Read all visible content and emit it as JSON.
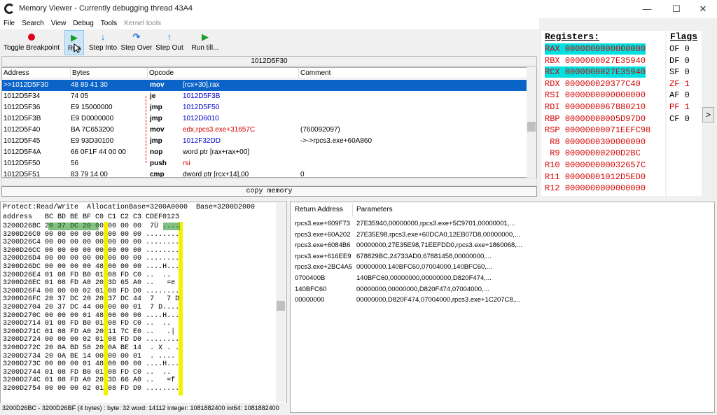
{
  "window": {
    "title": "Memory Viewer - Currently debugging thread 43A4",
    "minimize": "—",
    "maximize": "☐",
    "close": "✕"
  },
  "menu": [
    "File",
    "Search",
    "View",
    "Debug",
    "Tools",
    "Kernel tools"
  ],
  "toolbar": {
    "toggle_breakpoint": "Toggle Breakpoint",
    "run": "Run",
    "step_into": "Step Into",
    "step_over": "Step Over",
    "step_out": "Step Out",
    "run_till": "Run till..."
  },
  "disasm": {
    "address_header": "1012D5F30",
    "columns": [
      "Address",
      "Bytes",
      "Opcode",
      "Comment"
    ],
    "rows": [
      {
        "addr": ">>1012D5F30",
        "bytes": "48 89 41 30",
        "op": "mov",
        "args": "[rcx+30],rax",
        "comment": "",
        "selected": true
      },
      {
        "addr": "1012D5F34",
        "bytes": "74 05",
        "op": "je",
        "args": "1012D5F3B",
        "comment": ""
      },
      {
        "addr": "1012D5F36",
        "bytes": "E9 15000000",
        "op": "jmp",
        "args": "1012D5F50",
        "comment": ""
      },
      {
        "addr": "1012D5F3B",
        "bytes": "E9 D0000000",
        "op": "jmp",
        "args": "1012D6010",
        "comment": ""
      },
      {
        "addr": "1012D5F40",
        "bytes": "BA 7C653200",
        "op": "mov",
        "args": "edx,rpcs3.exe+31657C",
        "comment": "(760092097)"
      },
      {
        "addr": "1012D5F45",
        "bytes": "E9 93D30100",
        "op": "jmp",
        "args": "1012F32DD",
        "comment": "->->rpcs3.exe+60A860"
      },
      {
        "addr": "1012D5F4A",
        "bytes": "66 0F1F 44 00 00",
        "op": "nop",
        "args": "word ptr [rax+rax+00]",
        "comment": ""
      },
      {
        "addr": "1012D5F50",
        "bytes": "56",
        "op": "push",
        "args": "rsi",
        "comment": ""
      },
      {
        "addr": "1012D5F51",
        "bytes": "83 79 14 00",
        "op": "cmp",
        "args": "dword ptr [rcx+14],00",
        "comment": "0"
      }
    ]
  },
  "copy_memory": "copy memory",
  "registers": {
    "header": "Registers:",
    "list": [
      {
        "name": "RAX",
        "value": "0000000000000000",
        "hl": true
      },
      {
        "name": "RBX",
        "value": "0000000027E35940"
      },
      {
        "name": "RCX",
        "value": "0000000027E35940",
        "hl": true
      },
      {
        "name": "RDX",
        "value": "000000020377C40"
      },
      {
        "name": "RSI",
        "value": "0000000000000000"
      },
      {
        "name": "RDI",
        "value": "0000000067880210"
      },
      {
        "name": "RBP",
        "value": "00000000005D97D0"
      },
      {
        "name": "RSP",
        "value": "00000000071EEFC98"
      },
      {
        "name": " R8",
        "value": "0000000300000000"
      },
      {
        "name": " R9",
        "value": "00000000200D2BC"
      },
      {
        "name": "R10",
        "value": "000000000032657C"
      },
      {
        "name": "R11",
        "value": "00000001012D5ED0"
      },
      {
        "name": "R12",
        "value": "0000000000000000"
      }
    ]
  },
  "flags": {
    "header": "Flags",
    "list": [
      {
        "name": "OF",
        "value": "0",
        "red": false
      },
      {
        "name": "DF",
        "value": "0",
        "red": false
      },
      {
        "name": "SF",
        "value": "0",
        "red": false
      },
      {
        "name": "ZF",
        "value": "1",
        "red": true
      },
      {
        "name": "AF",
        "value": "0",
        "red": false
      },
      {
        "name": "PF",
        "value": "1",
        "red": true
      },
      {
        "name": "CF",
        "value": "0",
        "red": false
      }
    ]
  },
  "expand": ">",
  "hex": {
    "info": "Protect:Read/Write  AllocationBase=3200A0000  Base=3200D2000",
    "header": "address   BC BD BE BF C0 C1 C2 C3 CDEF0123",
    "rows": [
      {
        "addr": "3200D26BC",
        "bytes": "20 37 DC 20 00 00 00 00",
        "ascii": " 7Ü ...."
      },
      {
        "addr": "3200D26C0",
        "bytes": "00 00 00 00 00 00 00 00",
        "ascii": "........"
      },
      {
        "addr": "3200D26C4",
        "bytes": "00 00 00 00 00 00 00 00",
        "ascii": "........"
      },
      {
        "addr": "3200D26CC",
        "bytes": "00 00 00 00 00 00 00 00",
        "ascii": "........"
      },
      {
        "addr": "3200D26D4",
        "bytes": "00 00 00 00 00 00 00 00",
        "ascii": "........"
      },
      {
        "addr": "3200D26DC",
        "bytes": "00 00 00 00 48 00 00 00",
        "ascii": "....H..."
      },
      {
        "addr": "3200D26E4",
        "bytes": "01 08 FD B0 01 08 FD C0",
        "ascii": "..  ..  "
      },
      {
        "addr": "3200D26EC",
        "bytes": "01 08 FD A0 20 3D 65 A0",
        "ascii": "..   =e "
      },
      {
        "addr": "3200D26F4",
        "bytes": "00 00 00 02 01 08 FD D0",
        "ascii": "........"
      },
      {
        "addr": "3200D26FC",
        "bytes": "20 37 DC 20 20 37 DC 44",
        "ascii": " 7   7 D"
      },
      {
        "addr": "3200D2704",
        "bytes": "20 37 DC 44 00 00 00 01",
        "ascii": " 7 D...."
      },
      {
        "addr": "3200D270C",
        "bytes": "00 00 00 01 48 00 00 00",
        "ascii": "....H..."
      },
      {
        "addr": "3200D2714",
        "bytes": "01 08 FD B0 01 08 FD C0",
        "ascii": "..  ..  "
      },
      {
        "addr": "3200D271C",
        "bytes": "01 08 FD A0 20 11 7C E0",
        "ascii": "..   .| "
      },
      {
        "addr": "3200D2724",
        "bytes": "00 00 00 02 01 08 FD D0",
        "ascii": "........"
      },
      {
        "addr": "3200D272C",
        "bytes": "20 0A BD 58 20 0A BE 14",
        "ascii": " . X . ."
      },
      {
        "addr": "3200D2734",
        "bytes": "20 0A BE 14 00 00 00 01",
        "ascii": " . .... "
      },
      {
        "addr": "3200D273C",
        "bytes": "00 00 00 01 48 00 00 00",
        "ascii": "....H..."
      },
      {
        "addr": "3200D2744",
        "bytes": "01 08 FD B0 01 08 FD C0",
        "ascii": "..  ..  "
      },
      {
        "addr": "3200D274C",
        "bytes": "01 08 FD A0 20 3D 66 A0",
        "ascii": "..   =f "
      },
      {
        "addr": "3200D2754",
        "bytes": "00 00 00 02 01 08 FD D0",
        "ascii": "........"
      }
    ],
    "status": "3200D26BC - 3200D26BF (4 bytes) : byte: 32 word: 14112 integer: 1081882400 int64: 1081882400"
  },
  "stack": {
    "columns": [
      "Return Address",
      "Parameters"
    ],
    "rows": [
      {
        "ret": "rpcs3.exe+609F73",
        "params": "27E35940,00000000,rpcs3.exe+5C9701,00000001,..."
      },
      {
        "ret": "rpcs3.exe+60A202",
        "params": "27E35E98,rpcs3.exe+60DCA0,12EB07D8,00000000,..."
      },
      {
        "ret": "rpcs3.exe+6084B6",
        "params": "00000000,27E35E98,71EEFDD0,rpcs3.exe+1860068,..."
      },
      {
        "ret": "rpcs3.exe+616EE9",
        "params": "678829BC,24733AD0,67881458,00000000,..."
      },
      {
        "ret": "rpcs3.exe+2BC4A5",
        "params": "00000000,140BFC60,07004000,140BFC60,..."
      },
      {
        "ret": "0700400B",
        "params": "140BFC60,00000000,00000000,D820F474,..."
      },
      {
        "ret": "140BFC60",
        "params": "00000000,00000000,D820F474,07004000,..."
      },
      {
        "ret": "00000000",
        "params": "00000000,D820F474,07004000,rpcs3.exe+1C207C8,..."
      }
    ]
  }
}
